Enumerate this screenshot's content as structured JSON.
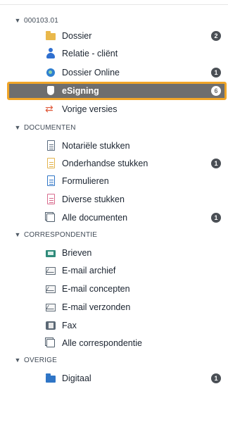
{
  "tree": {
    "root": {
      "label": "000103.01",
      "items": [
        {
          "label": "Dossier",
          "badge": "2",
          "icon": "folder-icon"
        },
        {
          "label": "Relatie - cliënt",
          "badge": "",
          "icon": "person-icon"
        },
        {
          "label": "Dossier Online",
          "badge": "1",
          "icon": "globe-icon"
        },
        {
          "label": "eSigning",
          "badge": "6",
          "icon": "shield-icon"
        },
        {
          "label": "Vorige versies",
          "badge": "",
          "icon": "versions-icon"
        }
      ]
    },
    "documenten": {
      "label": "DOCUMENTEN",
      "items": [
        {
          "label": "Notariële stukken",
          "badge": "",
          "icon": "document-icon"
        },
        {
          "label": "Onderhandse stukken",
          "badge": "1",
          "icon": "document-yellow-icon"
        },
        {
          "label": "Formulieren",
          "badge": "",
          "icon": "form-icon"
        },
        {
          "label": "Diverse stukken",
          "badge": "",
          "icon": "document-pink-icon"
        },
        {
          "label": "Alle documenten",
          "badge": "1",
          "icon": "documents-stack-icon"
        }
      ]
    },
    "correspondentie": {
      "label": "CORRESPONDENTIE",
      "items": [
        {
          "label": "Brieven",
          "badge": "",
          "icon": "letters-icon"
        },
        {
          "label": "E-mail archief",
          "badge": "",
          "icon": "mail-archive-icon"
        },
        {
          "label": "E-mail concepten",
          "badge": "",
          "icon": "mail-draft-icon"
        },
        {
          "label": "E-mail verzonden",
          "badge": "",
          "icon": "mail-sent-icon"
        },
        {
          "label": "Fax",
          "badge": "",
          "icon": "fax-icon"
        },
        {
          "label": "Alle correspondentie",
          "badge": "",
          "icon": "correspondence-stack-icon"
        }
      ]
    },
    "overige": {
      "label": "OVERIGE",
      "items": [
        {
          "label": "Digitaal",
          "badge": "1",
          "icon": "folder-icon"
        }
      ]
    }
  },
  "colors": {
    "selection_border": "#f0a528",
    "selection_bg": "#6e6e6e",
    "badge_bg": "#4a4f55"
  }
}
